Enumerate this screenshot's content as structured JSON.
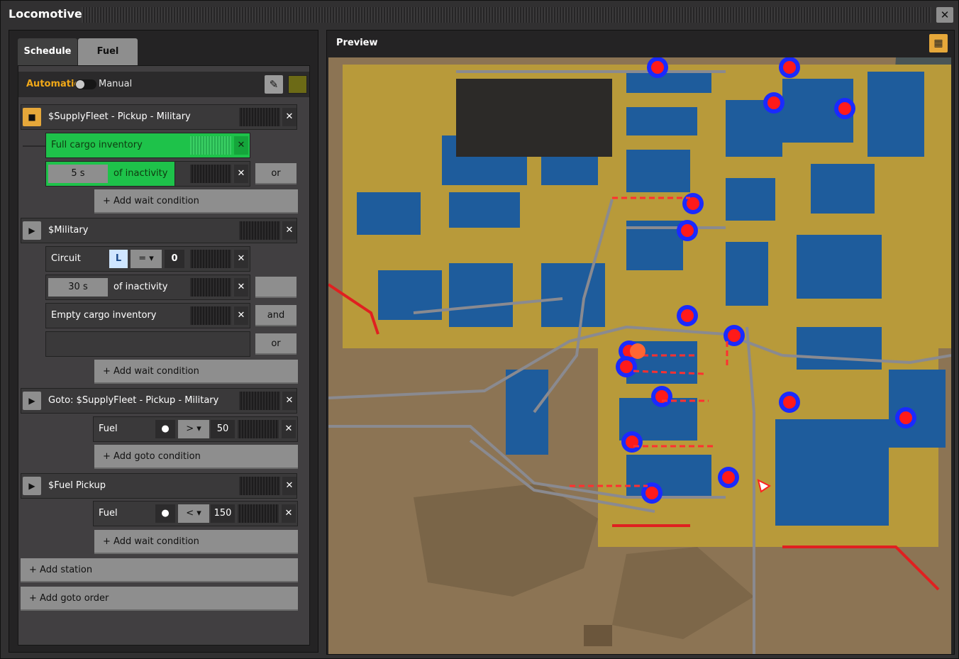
{
  "window": {
    "title": "Locomotive",
    "close": "✕"
  },
  "tabs": [
    {
      "label": "Schedule"
    },
    {
      "label": "Fuel"
    }
  ],
  "mode": {
    "automatic": "Automatic",
    "manual": "Manual"
  },
  "schedule": [
    {
      "name": "$SupplyFleet - Pickup - Military",
      "conditions": [
        {
          "label": "Full cargo inventory"
        },
        {
          "value": "5 s",
          "label": "of inactivity",
          "logic": "or"
        }
      ],
      "add_label": "+ Add wait condition"
    },
    {
      "name": "$Military",
      "conditions": [
        {
          "label": "Circuit",
          "signal": "L",
          "comparator": "=",
          "value": "0"
        },
        {
          "value": "30 s",
          "label": "of inactivity"
        },
        {
          "label": "Empty cargo inventory",
          "logic": "and"
        },
        {
          "label": "",
          "logic": "or"
        }
      ],
      "add_label": "+ Add wait condition"
    },
    {
      "name": "Goto: $SupplyFleet - Pickup - Military",
      "conditions": [
        {
          "label": "Fuel",
          "comparator": ">",
          "value": "50"
        }
      ],
      "add_label": "+ Add goto condition"
    },
    {
      "name": "$Fuel Pickup",
      "conditions": [
        {
          "label": "Fuel",
          "comparator": "<",
          "value": "150"
        }
      ],
      "add_label": "+ Add wait condition"
    }
  ],
  "add_station": "+ Add station",
  "add_goto": "+ Add goto order",
  "preview": {
    "label": "Preview"
  },
  "colors": {
    "accent": "#e6a83a",
    "active_condition": "#1ec24a",
    "rail": "#8a8a90",
    "building": "#1e5c9c",
    "belt": "#d8a838",
    "train": "#ff1a1a"
  }
}
